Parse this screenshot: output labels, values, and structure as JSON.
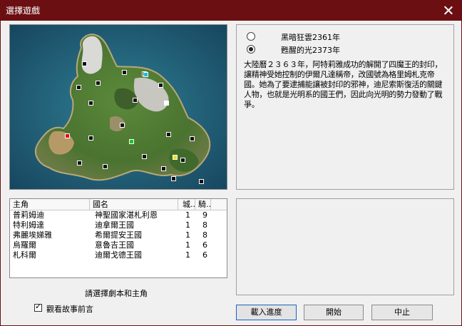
{
  "window": {
    "title": "選擇遊戲"
  },
  "scenarios": [
    {
      "label": "黑暗狂雲2361年",
      "selected": false
    },
    {
      "label": "甦醒的光2373年",
      "selected": true
    }
  ],
  "scenario_description": "大陸曆２３６３年，阿特莉雅成功的解開了四魔王的封印，讓精神受她控制的伊爾凡達稱帝，改國號為格里姆札克帝國。她為了要逮捕能讓被封印的邪神，迪尼索斯復活的關鍵人物，也就是光明系的國王們，因此向光明的勢力發動了戰爭。",
  "map": {
    "markers": [
      {
        "color": "#111111"
      },
      {
        "color": "#111111"
      },
      {
        "color": "#111111"
      },
      {
        "color": "#111111"
      },
      {
        "color": "#111111"
      },
      {
        "color": "#19b8e8"
      },
      {
        "color": "#111111"
      },
      {
        "color": "#111111"
      },
      {
        "color": "#111111"
      },
      {
        "color": "#ffffff"
      },
      {
        "color": "#111111"
      },
      {
        "color": "#e01010"
      },
      {
        "color": "#111111"
      },
      {
        "color": "#111111"
      },
      {
        "color": "#18c818"
      },
      {
        "color": "#111111"
      },
      {
        "color": "#111111"
      },
      {
        "color": "#f0e010"
      },
      {
        "color": "#111111"
      },
      {
        "color": "#111111"
      },
      {
        "color": "#111111"
      },
      {
        "color": "#111111"
      },
      {
        "color": "#111111"
      },
      {
        "color": "#111111"
      }
    ]
  },
  "table": {
    "headers": [
      "主角",
      "國名",
      "城...",
      "騎..."
    ],
    "rows": [
      {
        "hero": "普莉姆迪",
        "nation": "神聖國家湛札利恩",
        "castles": "1",
        "knights": "9"
      },
      {
        "hero": "特利姆達",
        "nation": "迪拿爾王國",
        "castles": "1",
        "knights": "8"
      },
      {
        "hero": "弗麗埃娣雅",
        "nation": "希爾提安王國",
        "castles": "1",
        "knights": "8"
      },
      {
        "hero": "烏羅爾",
        "nation": "意魯吉王國",
        "castles": "1",
        "knights": "6"
      },
      {
        "hero": "札科爾",
        "nation": "迪爾戈德王國",
        "castles": "1",
        "knights": "6"
      }
    ]
  },
  "hint": "請選擇劇本和主角",
  "watch_prologue": {
    "label": "觀看故事前言",
    "checked": true
  },
  "buttons": {
    "load": "載入進度",
    "start": "開始",
    "quit": "中止"
  }
}
